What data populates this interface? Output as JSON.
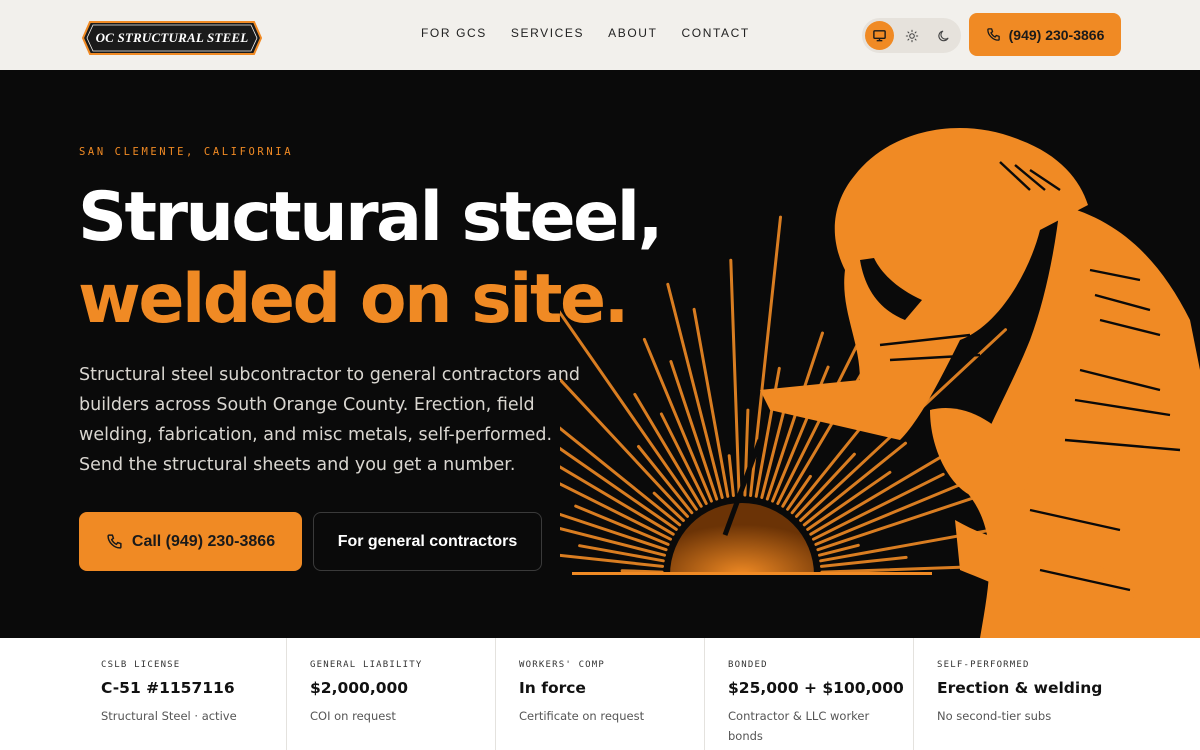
{
  "header": {
    "logo_text": "OC STRUCTURAL STEEL",
    "nav": [
      "FOR GCS",
      "SERVICES",
      "ABOUT",
      "CONTACT"
    ],
    "theme_modes": [
      "monitor-icon",
      "sun-icon",
      "moon-icon"
    ],
    "active_theme": "monitor-icon",
    "phone_label": "(949) 230-3866"
  },
  "hero": {
    "eyebrow": "SAN CLEMENTE, CALIFORNIA",
    "headline_line1": "Structural steel,",
    "headline_line2": "welded on site.",
    "lede": "Structural steel subcontractor to general contractors and builders across South Orange County. Erection, field welding, fabrication, and misc metals, self-performed. Send the structural sheets and you get a number.",
    "cta_primary": "Call (949) 230-3866",
    "cta_secondary": "For general contractors"
  },
  "credentials": [
    {
      "label": "CSLB LICENSE",
      "value": "C-51 #1157116",
      "note": "Structural Steel · active"
    },
    {
      "label": "GENERAL LIABILITY",
      "value": "$2,000,000",
      "note": "COI on request"
    },
    {
      "label": "WORKERS' COMP",
      "value": "In force",
      "note": "Certificate on request"
    },
    {
      "label": "BONDED",
      "value": "$25,000 + $100,000",
      "note": "Contractor & LLC worker bonds"
    },
    {
      "label": "SELF-PERFORMED",
      "value": "Erection & welding",
      "note": "No second-tier subs"
    }
  ],
  "colors": {
    "accent": "#f08a24",
    "hero_bg": "#0a0a0a",
    "header_bg": "#f2f0ec"
  }
}
